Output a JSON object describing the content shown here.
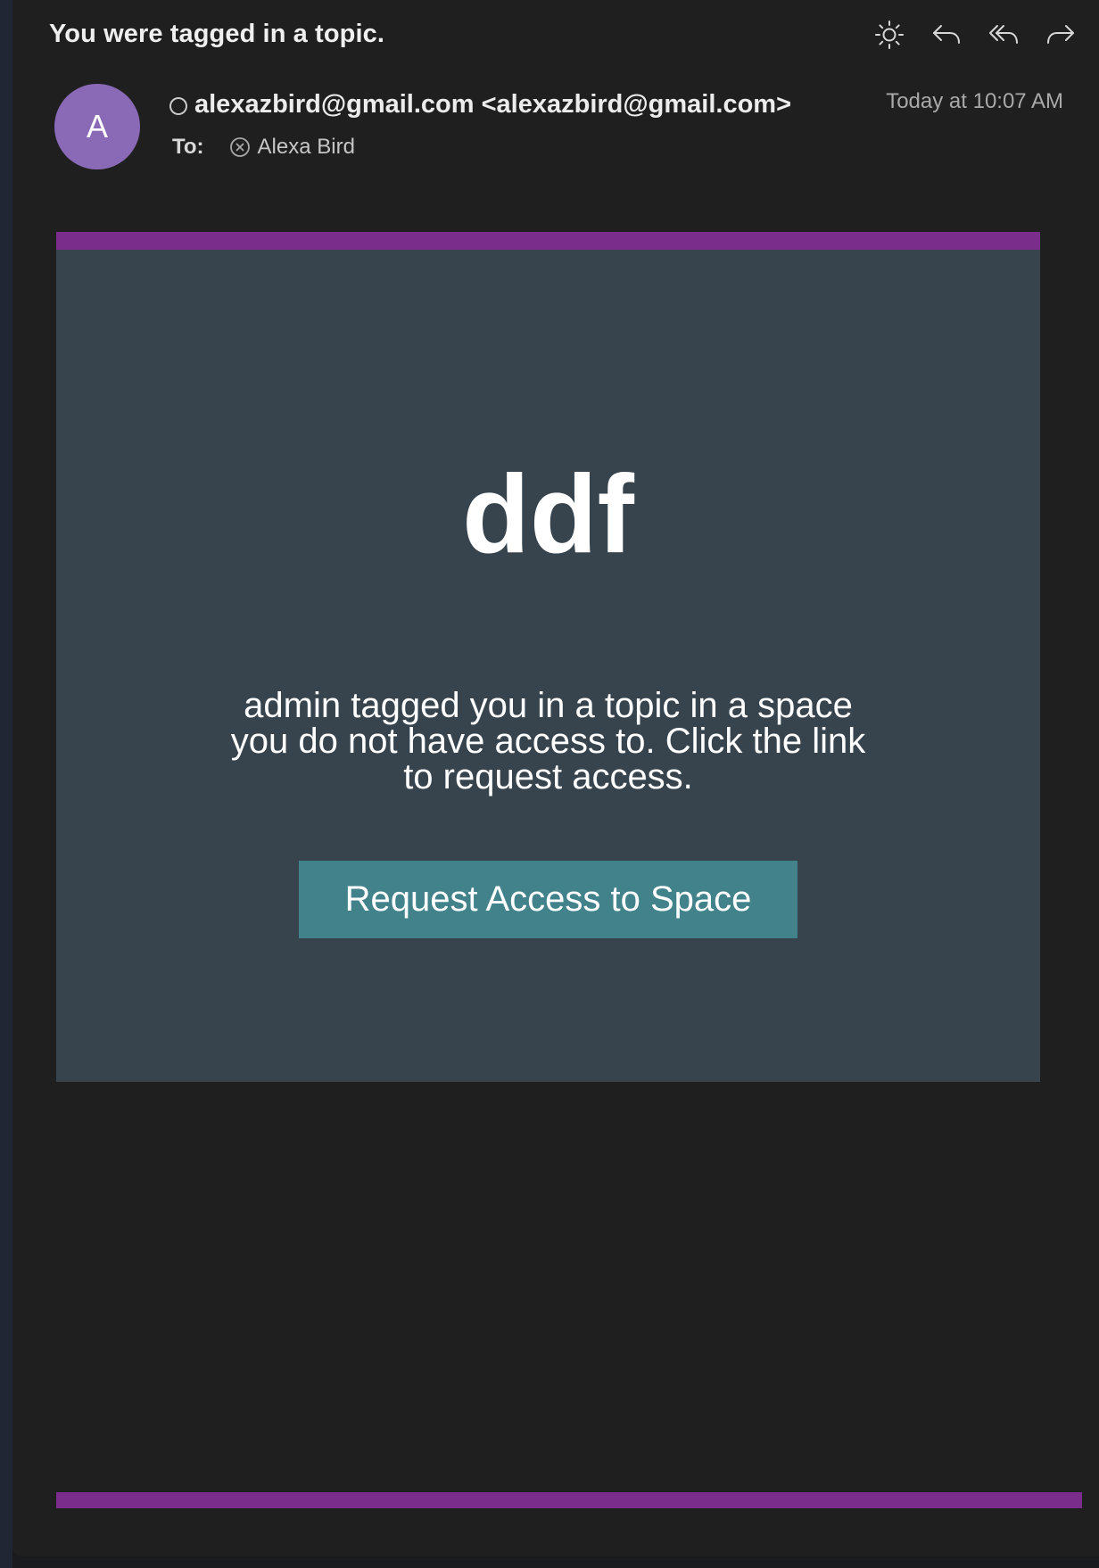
{
  "email": {
    "subject": "You were tagged in a topic.",
    "avatar_initial": "A",
    "sender": "alexazbird@gmail.com <alexazbird@gmail.com>",
    "timestamp": "Today at 10:07 AM",
    "to_label": "To:",
    "recipient": "Alexa Bird"
  },
  "toolbar": {
    "icons": [
      "brightness-icon",
      "reply-icon",
      "reply-all-icon",
      "forward-icon"
    ]
  },
  "body": {
    "headline": "ddf",
    "message": "admin tagged you in a topic in a space you do not have access to. Click the link to request access.",
    "cta_label": "Request Access to Space"
  },
  "colors": {
    "accent_purple": "#7b2d8b",
    "card_background": "#37444d",
    "button_teal": "#42828b",
    "avatar": "#8a6ab6",
    "window_background": "#1f1f20"
  }
}
